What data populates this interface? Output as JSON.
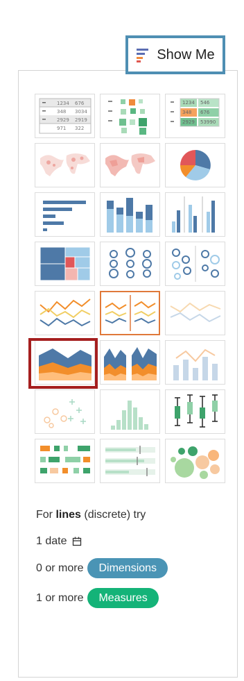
{
  "header": {
    "show_me_label": "Show Me",
    "icon": "show-me-icon"
  },
  "chart_types": [
    "text-table",
    "heat-map",
    "highlight-table",
    "symbol-map",
    "filled-map",
    "pie-chart",
    "horizontal-bars",
    "stacked-bars",
    "side-by-side-bars",
    "treemap",
    "circle-views",
    "side-by-side-circles",
    "continuous-lines",
    "discrete-lines",
    "dual-lines",
    "continuous-area",
    "discrete-area",
    "dual-combination",
    "scatter-plot",
    "histogram",
    "box-and-whisker",
    "gantt-chart",
    "bullet-graph",
    "packed-bubbles"
  ],
  "selected_chart": "continuous-area",
  "highlighted_chart": "discrete-lines",
  "text_table_values": [
    "1234",
    "676",
    "348",
    "3034",
    "2929",
    "2919",
    "971",
    "322"
  ],
  "highlight_table_values": [
    "1234",
    "546",
    "348",
    "676",
    "2929",
    "53990"
  ],
  "hint": {
    "prefix": "For ",
    "bold": "lines",
    "suffix": " (discrete) try"
  },
  "requirements": {
    "date_text": "1 date",
    "date_icon": "calendar-icon",
    "dimensions_prefix": "0 or more",
    "dimensions_pill": "Dimensions",
    "measures_prefix": "1 or more",
    "measures_pill": "Measures"
  },
  "colors": {
    "tab_border": "#4f8fb3",
    "selection_border": "#a51f1f",
    "active_thumb_border": "#e0793a",
    "dimensions_pill": "#4a94b5",
    "measures_pill": "#14b378"
  }
}
